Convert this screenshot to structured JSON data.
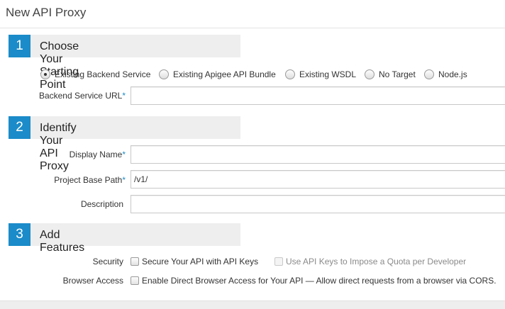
{
  "header": {
    "title": "New API Proxy"
  },
  "steps": [
    {
      "number": "1",
      "label": "Choose Your Starting Point"
    },
    {
      "number": "2",
      "label": "Identify Your API Proxy"
    },
    {
      "number": "3",
      "label": "Add Features"
    }
  ],
  "starting_point": {
    "options": [
      {
        "label": "Existing Backend Service",
        "selected": true
      },
      {
        "label": "Existing Apigee API Bundle",
        "selected": false
      },
      {
        "label": "Existing WSDL",
        "selected": false
      },
      {
        "label": "No Target",
        "selected": false
      },
      {
        "label": "Node.js",
        "selected": false
      }
    ],
    "backend_url": {
      "label": "Backend Service URL",
      "value": "",
      "required": "*"
    }
  },
  "identify": {
    "display_name": {
      "label": "Display Name",
      "value": "",
      "required": "*"
    },
    "base_path": {
      "label": "Project Base Path",
      "value": "/v1/",
      "required": "*"
    },
    "description": {
      "label": "Description",
      "value": ""
    }
  },
  "features": {
    "security_label": "Security",
    "secure_api": "Secure Your API with API Keys",
    "quota": "Use API Keys to Impose a Quota per Developer",
    "browser_label": "Browser Access",
    "cors": "Enable Direct Browser Access for Your API — Allow direct requests from a browser via CORS."
  }
}
